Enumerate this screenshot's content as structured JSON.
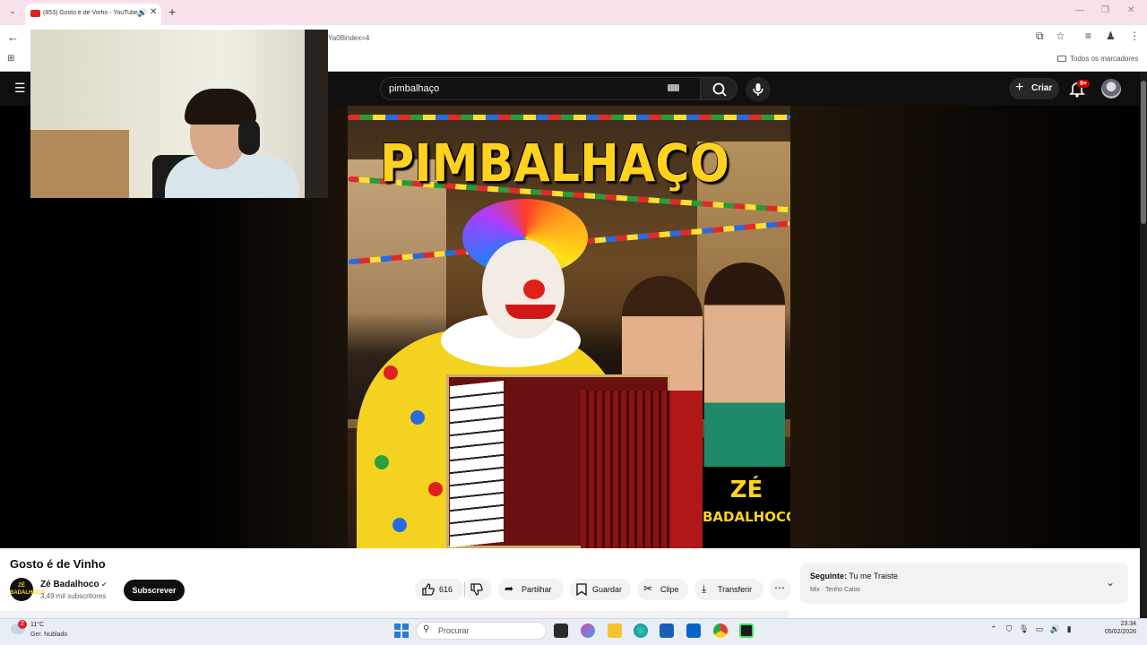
{
  "browser": {
    "tab_title": "(853) Gosto é de Vinho - YouTube",
    "url_fragment": "Ya08index=4",
    "bookmarks_label": "Todos os marcadores"
  },
  "youtube": {
    "search_query": "pimbalhaço",
    "create_label": "Criar",
    "notifications_badge": "9+"
  },
  "thumbnail": {
    "headline": "PIMBALHAÇO",
    "logo_line1": "ZÉ",
    "logo_line2": "BADALHOCO"
  },
  "video": {
    "title": "Gosto é de Vinho",
    "channel": "Zé Badalhoco",
    "subscribers": "3,49 mil subscritores",
    "channel_avatar_text": "ZÉ BADALHOCO",
    "subscribe_label": "Subscrever",
    "likes": "616",
    "share_label": "Partilhar",
    "save_label": "Guardar",
    "clip_label": "Clipe",
    "download_label": "Transferir"
  },
  "up_next": {
    "label": "Seguinte:",
    "title": "Tu me Traiste",
    "mix_label": "Mix",
    "artist": "Tenho Calos"
  },
  "taskbar": {
    "temperature": "11°C",
    "weather": "Ger. Nublado",
    "weather_badge": "2",
    "search_placeholder": "Procurar",
    "time": "23:34",
    "date": "05/02/2026"
  },
  "colors": {
    "accent_red": "#cc0000",
    "thumb_yellow": "#ffd21f",
    "tab_bar_pink": "#f7e1ea"
  }
}
